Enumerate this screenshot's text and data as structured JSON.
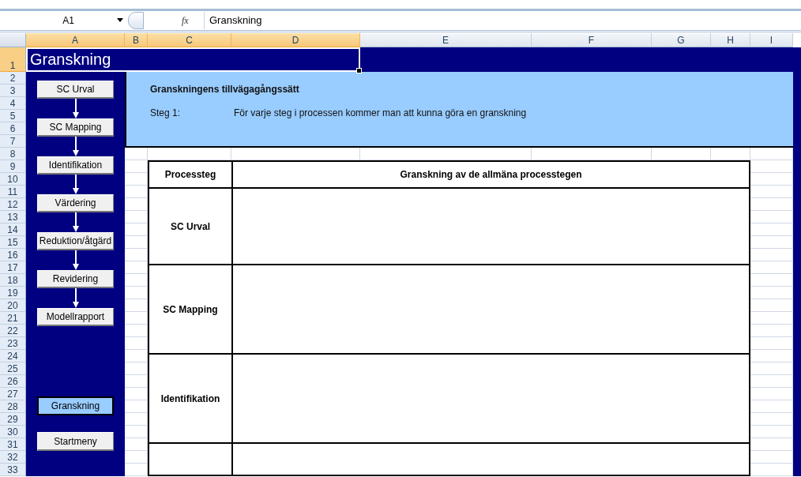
{
  "formula_bar": {
    "name_box": "A1",
    "function_label": "fx",
    "formula": "Granskning"
  },
  "columns": [
    {
      "label": "A",
      "selected": true
    },
    {
      "label": "B",
      "selected": true
    },
    {
      "label": "C",
      "selected": true
    },
    {
      "label": "D",
      "selected": true
    },
    {
      "label": "E",
      "selected": false
    },
    {
      "label": "F",
      "selected": false
    },
    {
      "label": "G",
      "selected": false
    },
    {
      "label": "H",
      "selected": false
    },
    {
      "label": "I",
      "selected": false
    }
  ],
  "rows": [
    {
      "label": "1",
      "selected": true
    },
    {
      "label": "2",
      "selected": false
    },
    {
      "label": "3",
      "selected": false
    },
    {
      "label": "4",
      "selected": false
    },
    {
      "label": "5",
      "selected": false
    },
    {
      "label": "6",
      "selected": false
    },
    {
      "label": "7",
      "selected": false
    },
    {
      "label": "8",
      "selected": false
    },
    {
      "label": "9",
      "selected": false
    },
    {
      "label": "10",
      "selected": false
    },
    {
      "label": "11",
      "selected": false
    },
    {
      "label": "12",
      "selected": false
    },
    {
      "label": "13",
      "selected": false
    },
    {
      "label": "14",
      "selected": false
    },
    {
      "label": "15",
      "selected": false
    },
    {
      "label": "16",
      "selected": false
    },
    {
      "label": "17",
      "selected": false
    },
    {
      "label": "18",
      "selected": false
    },
    {
      "label": "19",
      "selected": false
    },
    {
      "label": "20",
      "selected": false
    },
    {
      "label": "21",
      "selected": false
    },
    {
      "label": "22",
      "selected": false
    },
    {
      "label": "23",
      "selected": false
    },
    {
      "label": "24",
      "selected": false
    },
    {
      "label": "25",
      "selected": false
    },
    {
      "label": "26",
      "selected": false
    },
    {
      "label": "27",
      "selected": false
    },
    {
      "label": "28",
      "selected": false
    },
    {
      "label": "29",
      "selected": false
    },
    {
      "label": "30",
      "selected": false
    },
    {
      "label": "31",
      "selected": false
    },
    {
      "label": "32",
      "selected": false
    },
    {
      "label": "33",
      "selected": false
    }
  ],
  "title_cell": "Granskning",
  "flow_steps": [
    "SC Urval",
    "SC Mapping",
    "Identifikation",
    "Värdering",
    "Reduktion/åtgärd",
    "Revidering",
    "Modellrapport"
  ],
  "nav_buttons": [
    {
      "label": "Granskning",
      "selected": true
    },
    {
      "label": "Startmeny",
      "selected": false
    }
  ],
  "info_panel": {
    "title": "Granskningens tillvägagångssätt",
    "step_label": "Steg 1:",
    "step_text": "För varje steg i processen kommer man att kunna göra en granskning"
  },
  "review_table": {
    "columns": [
      "Processteg",
      "Granskning av de allmäna processtegen"
    ],
    "rows": [
      {
        "step": "SC Urval"
      },
      {
        "step": "SC Mapping"
      },
      {
        "step": "Identifikation"
      }
    ]
  }
}
